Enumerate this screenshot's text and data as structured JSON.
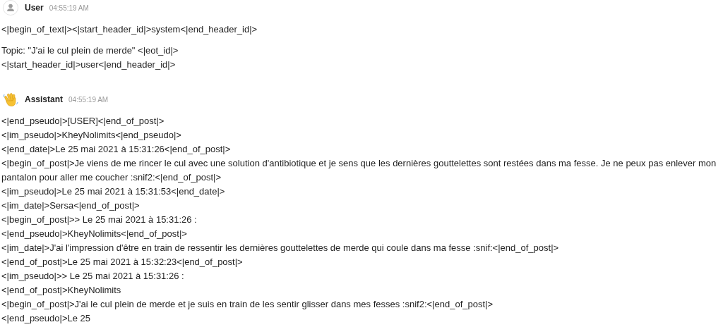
{
  "messages": [
    {
      "author": "User",
      "time": "04:55:19 AM",
      "avatar": {
        "kind": "person"
      },
      "paragraphs": [
        [
          "<|begin_of_text|><|start_header_id|>system<|end_header_id|>"
        ],
        [
          "Topic: \"J'ai le cul plein de merde\" <|eot_id|>",
          "<|start_header_id|>user<|end_header_id|>"
        ]
      ]
    },
    {
      "author": "Assistant",
      "time": "04:55:19 AM",
      "avatar": {
        "kind": "wave"
      },
      "paragraphs": [
        [
          "<|end_pseudo|>[USER]<|end_of_post|>",
          "<|im_pseudo|>KheyNolimits<|end_pseudo|>",
          "<|end_date|>Le 25 mai 2021 à 15:31:26<|end_of_post|>",
          "<|begin_of_post|>Je viens de me rincer le cul avec une solution d'antibiotique et je sens que les dernières gouttelettes sont restées dans ma fesse. Je ne peux pas enlever mon",
          "pantalon pour aller me coucher :snif2:<|end_of_post|>",
          "<|im_pseudo|>Le 25 mai 2021 à 15:31:53<|end_date|>",
          "<|im_date|>Sersa<|end_of_post|>",
          "<|begin_of_post|>> Le 25 mai 2021 à 15:31:26 :",
          "<|end_pseudo|>KheyNolimits<|end_of_post|>",
          "<|im_date|>J'ai l'impression d'être en train de ressentir les dernières gouttelettes de merde qui coule dans ma fesse :snif:<|end_of_post|>",
          "<|end_of_post|>Le 25 mai 2021 à 15:32:23<|end_of_post|>",
          "<|im_pseudo|>> Le 25 mai 2021 à 15:31:26 :",
          "<|end_of_post|>KheyNolimits",
          "<|begin_of_post|>J'ai le cul plein de merde et je suis en train de les sentir glisser dans mes fesses :snif2:<|end_of_post|>",
          "<|end_pseudo|>Le 25"
        ]
      ]
    }
  ]
}
